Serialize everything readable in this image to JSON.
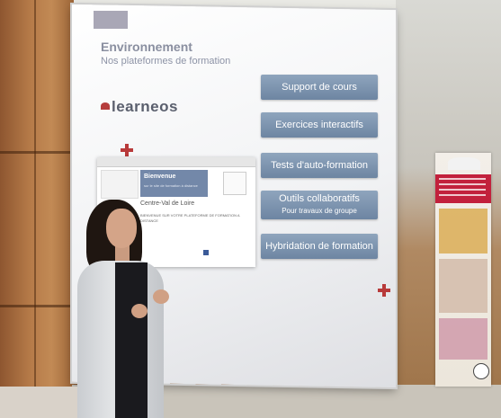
{
  "slide": {
    "title": "Environnement",
    "subtitle": "Nos plateformes de formation",
    "logo_text": "learneos",
    "menu": [
      {
        "label": "Support de cours"
      },
      {
        "label": "Exercices interactifs"
      },
      {
        "label": "Tests d'auto-formation"
      },
      {
        "label": "Outils collaboratifs",
        "sub": "Pour travaux de groupe"
      },
      {
        "label": "Hybridation de formation"
      }
    ],
    "embedded_site": {
      "banner_title": "Bienvenue",
      "banner_sub": "sur le site de formation à distance",
      "region": "Centre-Val de Loire",
      "welcome": "BIENVENUE SUR VOTRE PLATEFORME DE FORMATION A DISTANCE"
    }
  },
  "colors": {
    "menu_button": "#7a90ab",
    "accent_red": "#b83a3a",
    "slide_title": "#8a8fa0"
  },
  "icons": [
    "learneos-logo-icon",
    "red-cross-icon",
    "facebook-icon"
  ]
}
